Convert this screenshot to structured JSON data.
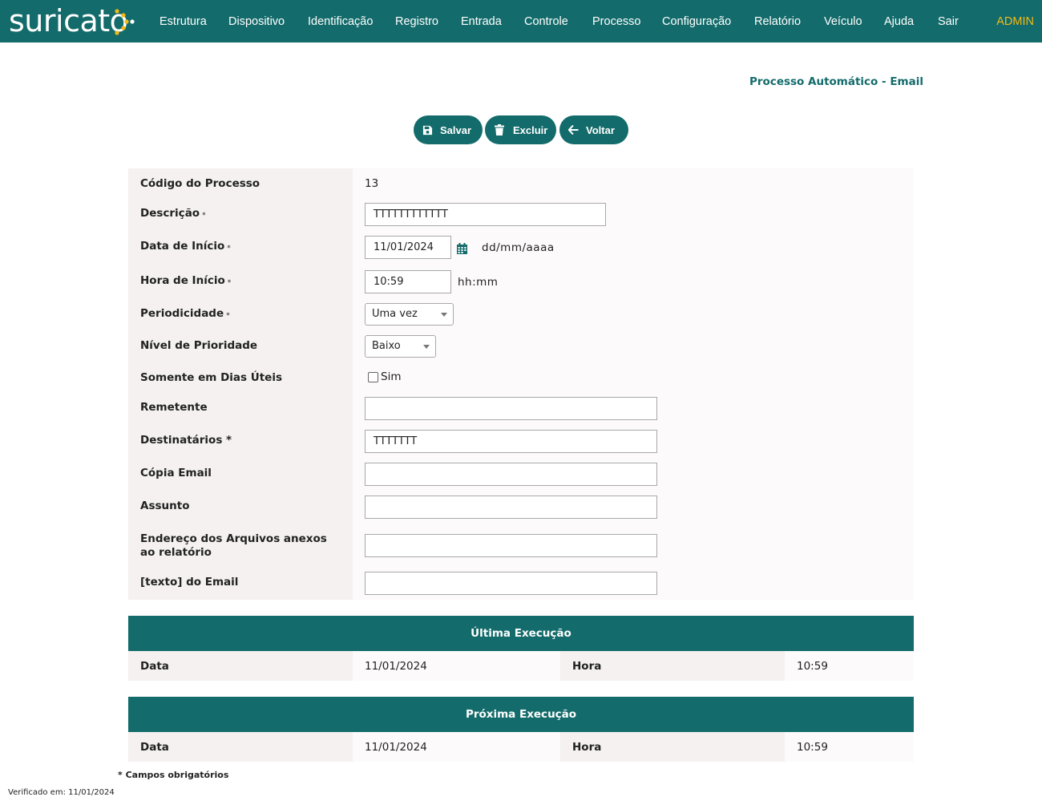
{
  "app": {
    "logo_text": "suricato",
    "nav": [
      "Estrutura",
      "Dispositivo",
      "Identificação",
      "Registro",
      "Entrada",
      "Controle",
      "Processo",
      "Configuração",
      "Relatório",
      "Veículo",
      "Ajuda",
      "Sair"
    ],
    "user": "ADMIN",
    "brand_color": "#146b6b",
    "accent_color": "#f5b914"
  },
  "page": {
    "title": "Processo Automático - Email"
  },
  "toolbar": {
    "save_label": "Salvar",
    "delete_label": "Excluir",
    "back_label": "Voltar",
    "save_icon": "floppy-disk-icon",
    "delete_icon": "trash-icon",
    "back_icon": "arrow-left-icon"
  },
  "form": {
    "codigo": {
      "label": "Código do Processo",
      "value": "13"
    },
    "descricao": {
      "label": "Descrição",
      "required": "*",
      "value": "TTTTTTTTTTTT"
    },
    "data_inicio": {
      "label": "Data de Início",
      "required": "*",
      "value": "11/01/2024",
      "hint": "dd/mm/aaaa",
      "icon": "calendar-icon"
    },
    "hora_inicio": {
      "label": "Hora de Início",
      "required": "*",
      "value": "10:59",
      "hint": "hh:mm"
    },
    "periodicidade": {
      "label": "Periodicidade",
      "required": "*",
      "value": "Uma vez"
    },
    "prioridade": {
      "label": "Nível de Prioridade",
      "value": "Baixo"
    },
    "dias_uteis": {
      "label": "Somente em Dias Úteis",
      "option": "Sim",
      "checked": false
    },
    "remetente": {
      "label": "Remetente",
      "value": ""
    },
    "destinatarios": {
      "label": "Destinatários *",
      "value": "TTTTTTT"
    },
    "copia": {
      "label": "Cópia Email",
      "value": ""
    },
    "assunto": {
      "label": "Assunto",
      "value": ""
    },
    "anexos": {
      "label": "Endereço dos Arquivos anexos ao relatório",
      "value": ""
    },
    "texto": {
      "label": "[texto] do Email",
      "value": ""
    }
  },
  "ultima": {
    "title": "Última Execução",
    "data_label": "Data",
    "data_value": "11/01/2024",
    "hora_label": "Hora",
    "hora_value": "10:59"
  },
  "proxima": {
    "title": "Próxima Execução",
    "data_label": "Data",
    "data_value": "11/01/2024",
    "hora_label": "Hora",
    "hora_value": "10:59"
  },
  "footer": {
    "required_note": "* Campos obrigatórios",
    "verified": "Verificado em: 11/01/2024"
  }
}
